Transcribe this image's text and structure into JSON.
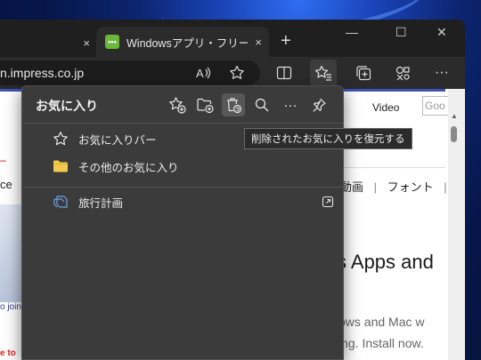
{
  "browser": {
    "tabs": [
      {
        "title": "",
        "close_icon": "×"
      },
      {
        "title": "Windowsアプリ・フリーソフトの",
        "favicon_text": "•••",
        "close_icon": "×"
      }
    ],
    "new_tab_label": "+",
    "window_controls": {
      "minimize": "—",
      "maximize": "☐",
      "close": "✕"
    }
  },
  "toolbar": {
    "address_text": "n.impress.co.jp",
    "more_label": "···"
  },
  "favorites_panel": {
    "title": "お気に入り",
    "items": [
      {
        "label": "お気に入りバー",
        "icon": "star-outline-icon"
      },
      {
        "label": "その他のお気に入り",
        "icon": "folder-icon"
      },
      {
        "label": "旅行計画",
        "icon": "collections-icon"
      }
    ],
    "more_label": "···",
    "tooltip": "削除されたお気に入りを復元する"
  },
  "webpage": {
    "video_link": "Video",
    "search_placeholder": "Goo",
    "nav_items": [
      "動画",
      "|",
      "フォント",
      "|"
    ],
    "left_fragment": "ce",
    "left_join": "o join",
    "left_red": "e to",
    "headline": "s Apps and",
    "subtext_line1": "ows and Mac w",
    "subtext_line2": "ing. Install now."
  },
  "colors": {
    "flyout_bg": "#3b3b3b",
    "titlebar_bg": "#1f1f1f",
    "tab_bg": "#2b2b2b",
    "folder_color": "#f2c94c",
    "collections_color": "#6aa0e6"
  }
}
